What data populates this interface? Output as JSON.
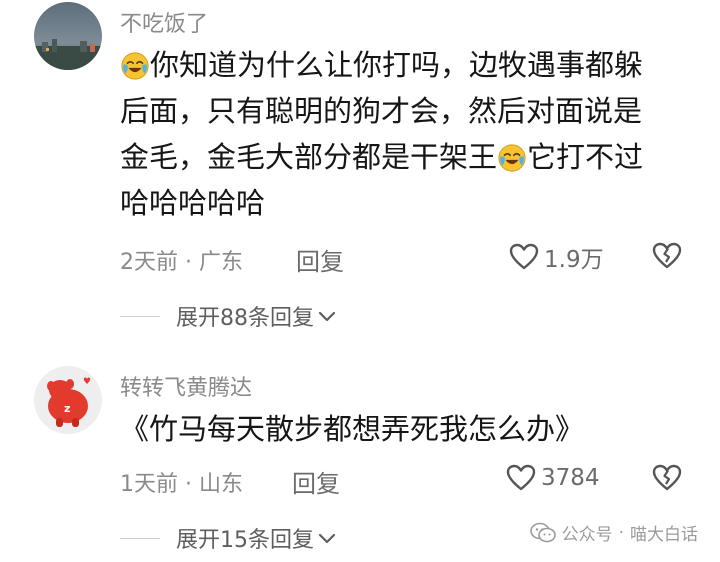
{
  "comments": [
    {
      "username": "不吃饭了",
      "lines": [
        {
          "before": "",
          "after": "你知道为什么让你打吗，边牧遇事都躲"
        },
        {
          "before": "后面，只有聪明的狗才会，然后对面说是",
          "after": ""
        },
        {
          "before": "金毛，金毛大部分都是干架王",
          "after": "它打不过"
        },
        {
          "before": "哈哈哈哈哈",
          "after": ""
        }
      ],
      "time": "2天前",
      "location": "广东",
      "reply_label": "回复",
      "like_count": "1.9万",
      "expand_label": "展开88条回复"
    },
    {
      "username": "转转飞黄腾达",
      "text": "《竹马每天散步都想弄死我怎么办》",
      "time": "1天前",
      "location": "山东",
      "reply_label": "回复",
      "like_count": "3784",
      "expand_label": "展开15条回复"
    }
  ],
  "separator": "·",
  "watermark": {
    "prefix": "公众号",
    "separator": "·",
    "name": "喵大白话"
  },
  "icons": {
    "emoji": "crying-laughing-emoji",
    "like": "heart-outline-icon",
    "dislike": "broken-heart-icon",
    "expand": "chevron-down-icon",
    "watermark": "wechat-icon"
  },
  "colors": {
    "text": "#161616",
    "secondary": "#8a8a8a",
    "emoji": "#f6c432"
  }
}
